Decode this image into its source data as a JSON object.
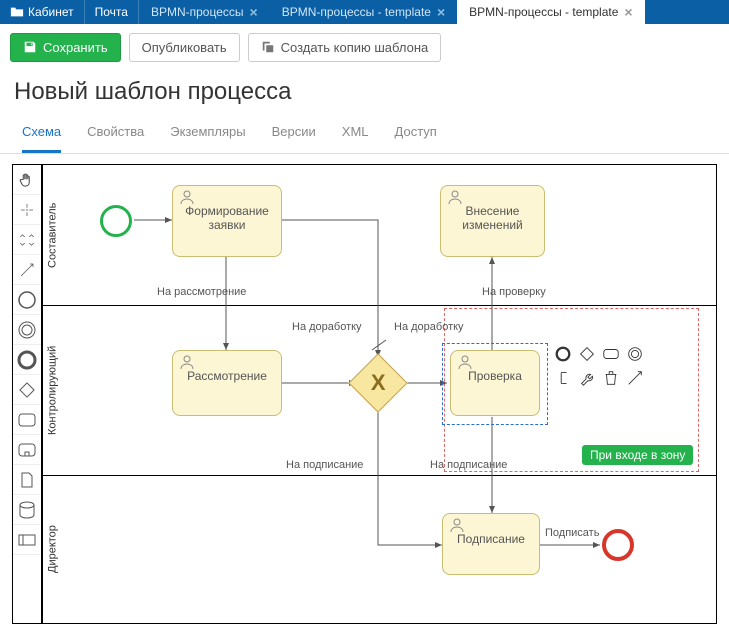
{
  "topbar": {
    "cabinet": "Кабинет",
    "mail": "Почта",
    "tabs": [
      {
        "label": "BPMN-процессы",
        "active": false
      },
      {
        "label": "BPMN-процессы - template",
        "active": false
      },
      {
        "label": "BPMN-процессы - template",
        "active": true
      }
    ]
  },
  "toolbar": {
    "save": "Сохранить",
    "publish": "Опубликовать",
    "copy": "Создать копию шаблона"
  },
  "page_title": "Новый шаблон процесса",
  "tabs": {
    "schema": "Схема",
    "properties": "Свойства",
    "instances": "Экземпляры",
    "versions": "Версии",
    "xml": "XML",
    "access": "Доступ"
  },
  "lanes": {
    "l0": "Составитель",
    "l1": "Контролирующий",
    "l2": "Директор"
  },
  "tasks": {
    "form_request": "Формирование заявки",
    "make_changes": "Внесение изменений",
    "review": "Рассмотрение",
    "check": "Проверка",
    "sign": "Подписание"
  },
  "flows": {
    "to_review": "На рассмотрение",
    "to_rework1": "На доработку",
    "to_rework2": "На доработку",
    "to_check": "На проверку",
    "to_sign1": "На подписание",
    "to_sign2": "На подписание",
    "sign_act": "Подписать"
  },
  "badge": "При входе в зону",
  "gateway_mark": "X"
}
